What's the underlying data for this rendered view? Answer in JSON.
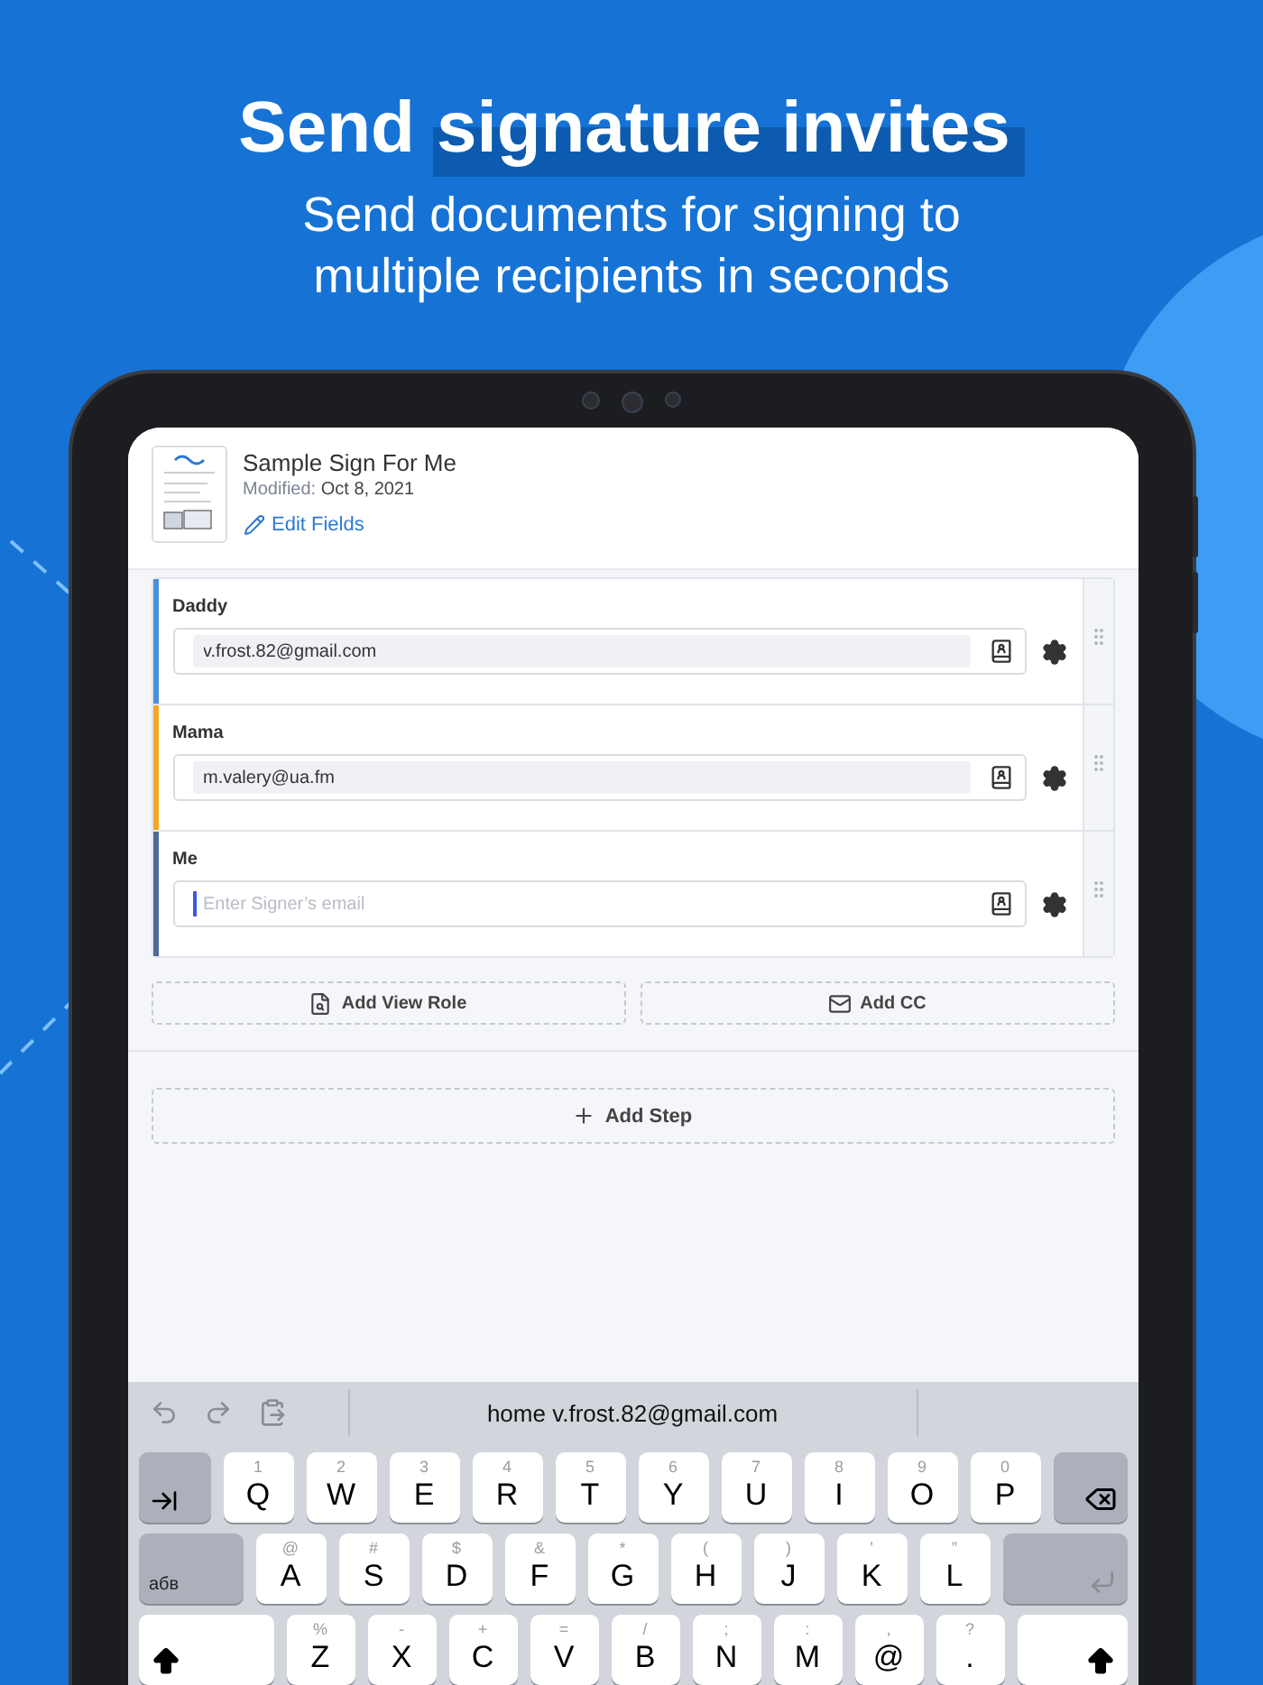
{
  "headline": {
    "plain": "Send",
    "highlight": "signature invites"
  },
  "subtitle": [
    "Send documents for signing to",
    "multiple recipients in seconds"
  ],
  "document": {
    "title": "Sample Sign For Me",
    "modified_label": "Modified:",
    "modified_date": "Oct 8, 2021",
    "edit_link": "Edit Fields"
  },
  "signers": [
    {
      "role": "Daddy",
      "email": "v.frost.82@gmail.com",
      "color": "#4a90d9",
      "focused": false
    },
    {
      "role": "Mama",
      "email": "m.valery@ua.fm",
      "color": "#f5a623",
      "focused": false
    },
    {
      "role": "Me",
      "placeholder": "Enter Signer’s email",
      "color": "#4f6a94",
      "focused": true
    }
  ],
  "actions": [
    "Add View Role",
    "Add CC"
  ],
  "add_step": "Add Step",
  "keyboard": {
    "suggestion": "home v.frost.82@gmail.com",
    "rows": [
      [
        {
          "kind": "tab"
        },
        {
          "kind": "letter",
          "main": "Q",
          "alt": "1"
        },
        {
          "kind": "letter",
          "main": "W",
          "alt": "2"
        },
        {
          "kind": "letter",
          "main": "E",
          "alt": "3"
        },
        {
          "kind": "letter",
          "main": "R",
          "alt": "4"
        },
        {
          "kind": "letter",
          "main": "T",
          "alt": "5"
        },
        {
          "kind": "letter",
          "main": "Y",
          "alt": "6"
        },
        {
          "kind": "letter",
          "main": "U",
          "alt": "7"
        },
        {
          "kind": "letter",
          "main": "I",
          "alt": "8"
        },
        {
          "kind": "letter",
          "main": "O",
          "alt": "9"
        },
        {
          "kind": "letter",
          "main": "P",
          "alt": "0"
        },
        {
          "kind": "backspace"
        }
      ],
      [
        {
          "kind": "lang",
          "main": "абв"
        },
        {
          "kind": "letter",
          "main": "A",
          "alt": "@"
        },
        {
          "kind": "letter",
          "main": "S",
          "alt": "#"
        },
        {
          "kind": "letter",
          "main": "D",
          "alt": "$"
        },
        {
          "kind": "letter",
          "main": "F",
          "alt": "&"
        },
        {
          "kind": "letter",
          "main": "G",
          "alt": "*"
        },
        {
          "kind": "letter",
          "main": "H",
          "alt": "("
        },
        {
          "kind": "letter",
          "main": "J",
          "alt": ")"
        },
        {
          "kind": "letter",
          "main": "K",
          "alt": "’"
        },
        {
          "kind": "letter",
          "main": "L",
          "alt": "”"
        },
        {
          "kind": "return"
        }
      ],
      [
        {
          "kind": "shift"
        },
        {
          "kind": "letter",
          "main": "Z",
          "alt": "%"
        },
        {
          "kind": "letter",
          "main": "X",
          "alt": "-"
        },
        {
          "kind": "letter",
          "main": "C",
          "alt": "+"
        },
        {
          "kind": "letter",
          "main": "V",
          "alt": "="
        },
        {
          "kind": "letter",
          "main": "B",
          "alt": "/"
        },
        {
          "kind": "letter",
          "main": "N",
          "alt": ";"
        },
        {
          "kind": "letter",
          "main": "M",
          "alt": ":"
        },
        {
          "kind": "letter",
          "main": "@",
          "alt": ","
        },
        {
          "kind": "letter",
          "main": ".",
          "alt": "?"
        },
        {
          "kind": "shift"
        }
      ]
    ]
  }
}
